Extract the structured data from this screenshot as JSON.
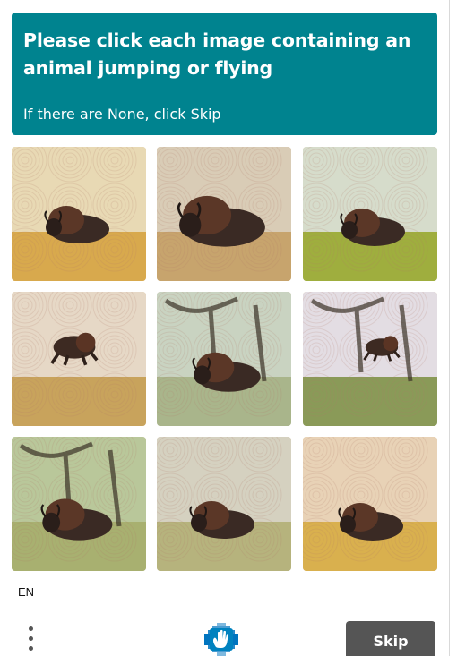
{
  "prompt": {
    "title": "Please click each image containing an animal jumping or flying",
    "subtitle": "If there are None, click Skip",
    "color": "#00838f"
  },
  "grid": {
    "tiles": [
      {
        "subject": "bison lying in field",
        "sky": "#e8d9b4",
        "ground": "#d8a94d"
      },
      {
        "subject": "bison resting front view",
        "sky": "#d9ccb6",
        "ground": "#c7a46d"
      },
      {
        "subject": "bison lying in grassy field",
        "sky": "#d6dccb",
        "ground": "#9fae3e"
      },
      {
        "subject": "bison leaping in air",
        "sky": "#e6d8c6",
        "ground": "#c8a35c"
      },
      {
        "subject": "bison lying under tree",
        "sky": "#c9d3c1",
        "ground": "#a9b58b"
      },
      {
        "subject": "bison flying near tree",
        "sky": "#e3dde3",
        "ground": "#8a9a58"
      },
      {
        "subject": "bison lying by tree",
        "sky": "#b9c79a",
        "ground": "#a8b070"
      },
      {
        "subject": "bison lying in meadow",
        "sky": "#d5d1c0",
        "ground": "#b6b37d"
      },
      {
        "subject": "bison lying on plain",
        "sky": "#e8d2b6",
        "ground": "#d9b04e"
      }
    ]
  },
  "footer": {
    "language": "EN",
    "menu_icon": "kebab-menu-icon",
    "logo_icon": "hcaptcha-hand-logo-icon",
    "skip_label": "Skip",
    "skip_color": "#555555"
  }
}
